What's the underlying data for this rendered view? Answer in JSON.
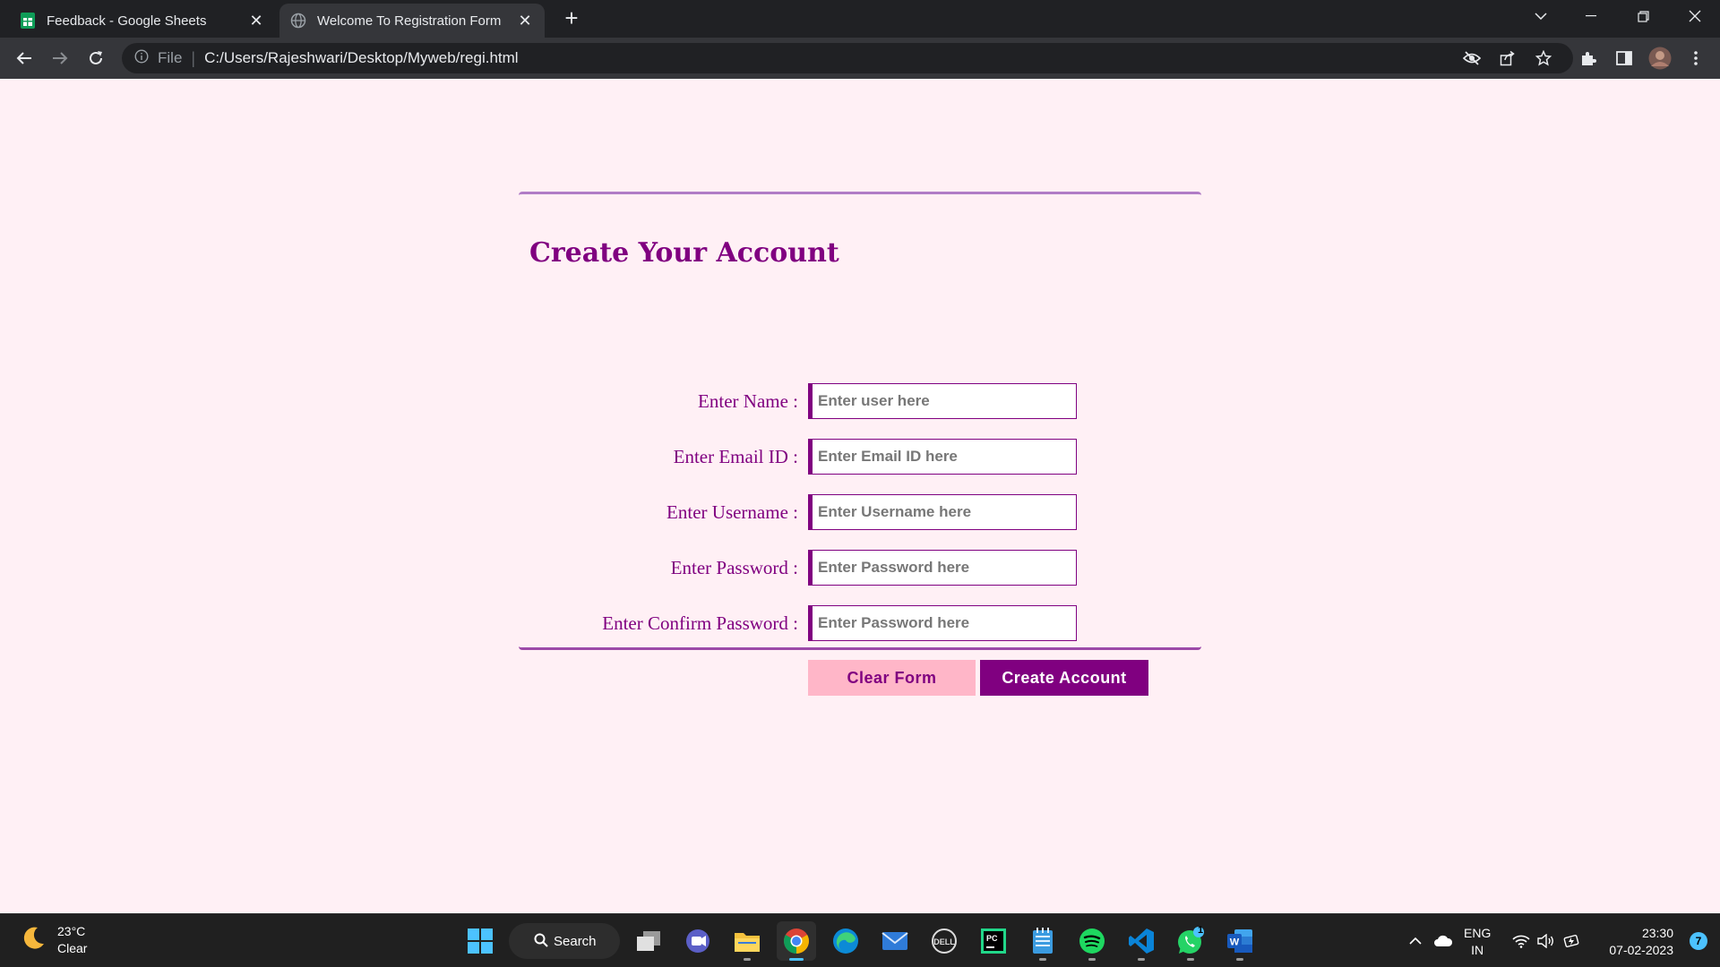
{
  "browser": {
    "tabs": [
      {
        "title": "Feedback - Google Sheets",
        "icon": "google-sheets-icon",
        "active": false
      },
      {
        "title": "Welcome To Registration Form",
        "icon": "globe-icon",
        "active": true
      }
    ],
    "address": {
      "scheme_label": "File",
      "url": "C:/Users/Rajeshwari/Desktop/Myweb/regi.html"
    }
  },
  "form": {
    "title": "Create Your Account",
    "fields": [
      {
        "label": "Enter Name :",
        "placeholder": "Enter user here",
        "type": "text"
      },
      {
        "label": "Enter Email ID :",
        "placeholder": "Enter Email ID here",
        "type": "email"
      },
      {
        "label": "Enter Username :",
        "placeholder": "Enter Username here",
        "type": "text"
      },
      {
        "label": "Enter Password :",
        "placeholder": "Enter Password here",
        "type": "password"
      },
      {
        "label": "Enter Confirm Password :",
        "placeholder": "Enter Password here",
        "type": "password"
      }
    ],
    "clear_label": "Clear Form",
    "create_label": "Create Account"
  },
  "colors": {
    "accent": "#800080",
    "page_bg": "#fff0f5",
    "clear_bg": "#ffb6c8"
  },
  "taskbar": {
    "weather": {
      "temp": "23°C",
      "condition": "Clear"
    },
    "search_label": "Search",
    "apps": [
      "task-view-icon",
      "teams-chat-icon",
      "file-explorer-icon",
      "chrome-icon",
      "edge-icon",
      "mail-icon",
      "dell-icon",
      "pycharm-icon",
      "notepad-icon",
      "spotify-icon",
      "vscode-icon",
      "whatsapp-icon",
      "word-icon"
    ],
    "whatsapp_badge": "1",
    "language": {
      "line1": "ENG",
      "line2": "IN"
    },
    "time": "23:30",
    "date": "07-02-2023",
    "notification_count": "7"
  }
}
